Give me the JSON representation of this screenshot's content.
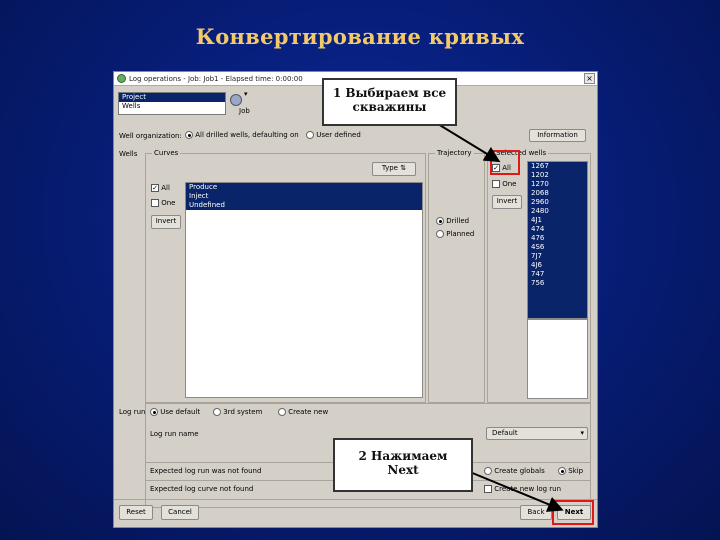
{
  "slide": {
    "title": "Конвертирование кривых"
  },
  "window": {
    "title": "Log operations - Job: Job1 - Elapsed time: 0:00:00"
  },
  "top": {
    "project": "Project",
    "wells": "Wells",
    "job_label": "Job"
  },
  "org": {
    "label": "Well organization:",
    "opt1": "All drilled wells, defaulting on",
    "opt2": "User defined",
    "info_button": "Information"
  },
  "wells_group": {
    "label": "Wells"
  },
  "curves": {
    "label": "Curves",
    "type_button": "Type",
    "all": "All",
    "one": "One",
    "invert": "Invert",
    "items": [
      "Produce",
      "Inject",
      "Undefined"
    ]
  },
  "trajectory": {
    "label": "Trajectory",
    "opt1": "Drilled",
    "opt2": "Planned"
  },
  "wellpicks": {
    "label": "Selected wells",
    "all": "All",
    "one": "One",
    "invert": "Invert",
    "items": [
      "1267",
      "1202",
      "1270",
      "2068",
      "2960",
      "2480",
      "4J1",
      "474",
      "476",
      "4S6",
      "7J7",
      "4J6",
      "747",
      "756"
    ]
  },
  "logrun": {
    "label": "Log run",
    "opt1": "Use default",
    "opt2": "3rd system",
    "opt3": "Create new"
  },
  "logrun_name": {
    "label": "Log run name",
    "value": "Default"
  },
  "rows": {
    "row1": "Expected log run was not found",
    "row1_opt1": "Create globals",
    "row1_opt2": "Skip",
    "row2": "Expected log curve not found",
    "row2_opt": "Create new log run"
  },
  "buttons": {
    "reset": "Reset",
    "cancel": "Cancel",
    "back": "Back",
    "next": "Next"
  },
  "callouts": {
    "c1_line1": "1 Выбираем все",
    "c1_line2": "скважины",
    "c2_line1": "2 Нажимаем",
    "c2_line2": "Next"
  },
  "colors": {
    "highlight": "#e01818",
    "selection": "#0a246a",
    "title": "#f4c96a"
  }
}
